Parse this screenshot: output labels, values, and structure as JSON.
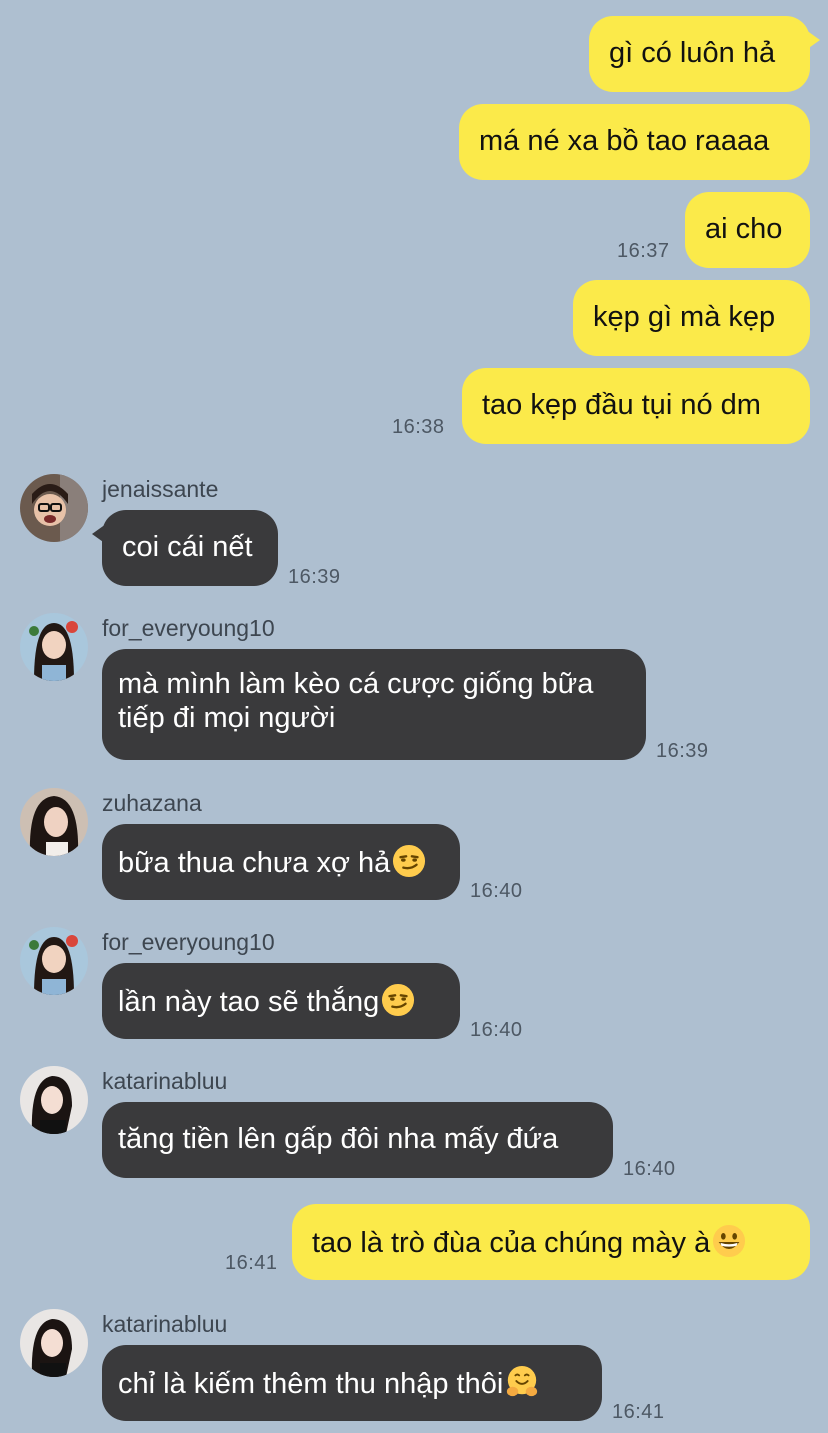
{
  "colors": {
    "background": "#aebfd0",
    "outgoing_bubble": "#fbea4a",
    "incoming_bubble": "#3a3a3c",
    "timestamp": "#4d5864"
  },
  "messages": [
    {
      "side": "out",
      "text": "gì có luôn hả",
      "time": ""
    },
    {
      "side": "out",
      "text": "má né xa bồ tao raaaa",
      "time": ""
    },
    {
      "side": "out",
      "text": "ai cho",
      "time": "16:37"
    },
    {
      "side": "out",
      "text": "kẹp gì mà kẹp",
      "time": ""
    },
    {
      "side": "out",
      "text": "tao kẹp đầu tụi nó dm",
      "time": "16:38"
    },
    {
      "side": "in",
      "sender": "jenaissante",
      "text": "coi cái nết",
      "time": "16:39"
    },
    {
      "side": "in",
      "sender": "for_everyoung10",
      "text": "mà mình làm kèo cá cược giống bữa tiếp đi mọi người",
      "time": "16:39"
    },
    {
      "side": "in",
      "sender": "zuhazana",
      "text": "bữa thua chưa xợ hả",
      "emoji": "smirk-emoji",
      "time": "16:40"
    },
    {
      "side": "in",
      "sender": "for_everyoung10",
      "text": "lần này tao sẽ thắng",
      "emoji": "smirk-emoji",
      "time": "16:40"
    },
    {
      "side": "in",
      "sender": "katarinabluu",
      "text": "tăng tiền lên gấp đôi nha mấy đứa",
      "time": "16:40"
    },
    {
      "side": "out",
      "text": "tao là trò đùa của chúng mày à",
      "emoji": "grinning-emoji",
      "time": "16:41"
    },
    {
      "side": "in",
      "sender": "katarinabluu",
      "text": "chỉ là kiếm thêm thu nhập thôi",
      "emoji": "hugging-emoji",
      "time": "16:41"
    }
  ]
}
